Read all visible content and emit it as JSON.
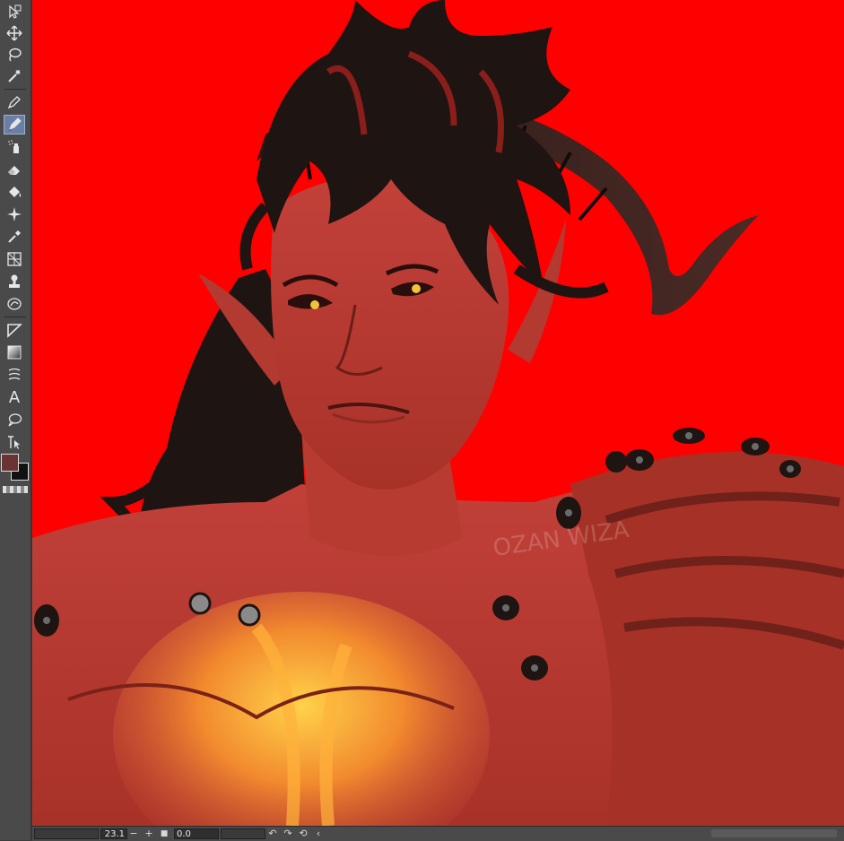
{
  "colors": {
    "canvas_bg": "#ff0000",
    "main_color": "#6b3333",
    "sub_color": "#111111",
    "toolbar_bg": "#4a4a4a",
    "active_tool": "#6a7fa6"
  },
  "tools": [
    {
      "name": "operation-tool-icon",
      "active": false
    },
    {
      "name": "move-tool-icon",
      "active": false
    },
    {
      "name": "lasso-select-icon",
      "active": false
    },
    {
      "name": "magic-wand-icon",
      "active": false
    },
    {
      "name": "pen-tool-icon",
      "active": false
    },
    {
      "name": "pencil-tool-icon",
      "active": true
    },
    {
      "name": "airbrush-tool-icon",
      "active": false
    },
    {
      "name": "eraser-tool-icon",
      "active": false
    },
    {
      "name": "fill-tool-icon",
      "active": false
    },
    {
      "name": "decoration-tool-icon",
      "active": false
    },
    {
      "name": "eyedropper-tool-icon",
      "active": false
    },
    {
      "name": "ruler-tool-icon",
      "active": false
    },
    {
      "name": "stamp-tool-icon",
      "active": false
    },
    {
      "name": "blend-tool-icon",
      "active": false
    },
    {
      "name": "frame-border-tool-icon",
      "active": false
    },
    {
      "name": "gradient-tool-icon",
      "active": false
    },
    {
      "name": "figure-tool-icon",
      "active": false
    },
    {
      "name": "text-tool-icon",
      "active": false
    },
    {
      "name": "balloon-tool-icon",
      "active": false
    },
    {
      "name": "correct-line-tool-icon",
      "active": false
    }
  ],
  "text_tool_glyph": "A",
  "statusbar": {
    "zoom": "23.1",
    "zoom_minus": "−",
    "zoom_plus": "+",
    "rotation": "0.0",
    "rotate_left": "↶",
    "rotate_right": "↷",
    "reset": "⟲",
    "more": "‹"
  },
  "artwork": {
    "subject": "horned-demon-character-portrait",
    "watermark": "OZAN WIZA"
  }
}
